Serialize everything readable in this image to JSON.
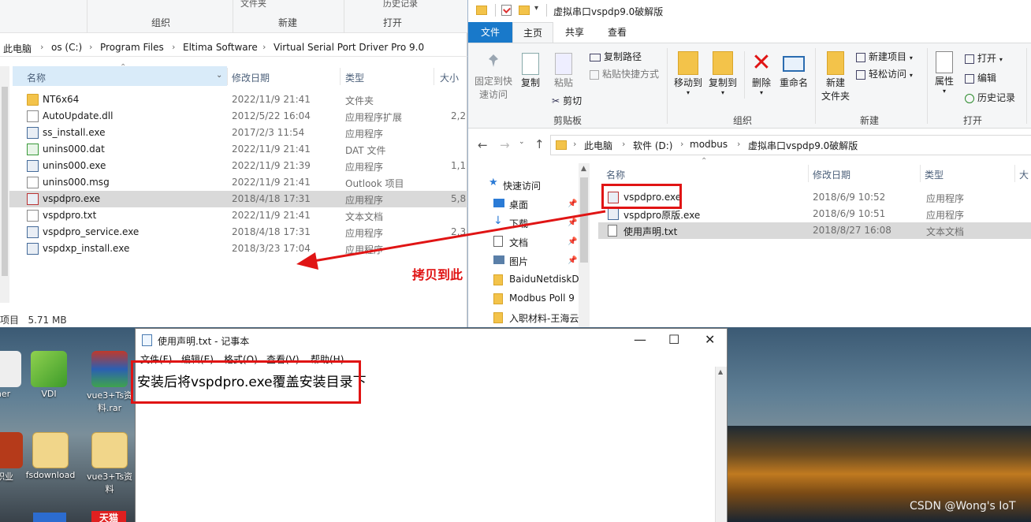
{
  "left_explorer": {
    "ribbon_top": [
      "文件夹",
      "历史记录"
    ],
    "ribbon_groups": [
      "组织",
      "新建",
      "打开"
    ],
    "breadcrumb": [
      "此电脑",
      "os (C:)",
      "Program Files",
      "Eltima Software",
      "Virtual Serial Port Driver Pro 9.0"
    ],
    "columns": {
      "name": "名称",
      "date": "修改日期",
      "type": "类型",
      "size": "大小"
    },
    "files": [
      {
        "name": "NT6x64",
        "date": "2022/11/9 21:41",
        "type": "文件夹",
        "size": "",
        "icon": "folder-icon"
      },
      {
        "name": "AutoUpdate.dll",
        "date": "2012/5/22 16:04",
        "type": "应用程序扩展",
        "size": "2,2",
        "icon": "dll-icon"
      },
      {
        "name": "ss_install.exe",
        "date": "2017/2/3 11:54",
        "type": "应用程序",
        "size": "",
        "icon": "exe-icon"
      },
      {
        "name": "unins000.dat",
        "date": "2022/11/9 21:41",
        "type": "DAT 文件",
        "size": "",
        "icon": "dat-icon"
      },
      {
        "name": "unins000.exe",
        "date": "2022/11/9 21:39",
        "type": "应用程序",
        "size": "1,1",
        "icon": "exe-icon"
      },
      {
        "name": "unins000.msg",
        "date": "2022/11/9 21:41",
        "type": "Outlook 项目",
        "size": "",
        "icon": "msg-icon"
      },
      {
        "name": "vspdpro.exe",
        "date": "2018/4/18 17:31",
        "type": "应用程序",
        "size": "5,8",
        "icon": "exe-icon"
      },
      {
        "name": "vspdpro.txt",
        "date": "2022/11/9 21:41",
        "type": "文本文档",
        "size": "",
        "icon": "txt-icon"
      },
      {
        "name": "vspdpro_service.exe",
        "date": "2018/4/18 17:31",
        "type": "应用程序",
        "size": "2,3",
        "icon": "exe-icon"
      },
      {
        "name": "vspdxp_install.exe",
        "date": "2018/3/23 17:04",
        "type": "应用程序",
        "size": "",
        "icon": "exe-icon"
      }
    ],
    "status": "项目   5.71 MB"
  },
  "right_explorer": {
    "title": "虚拟串口vspdp9.0破解版",
    "tabs": [
      "文件",
      "主页",
      "共享",
      "查看"
    ],
    "ribbon": {
      "pin_quick": "固定到快\n速访问",
      "copy": "复制",
      "paste": "粘贴",
      "copy_path": "复制路径",
      "paste_shortcut": "粘贴快捷方式",
      "cut": "剪切",
      "move_to": "移动到",
      "copy_to": "复制到",
      "delete": "删除",
      "rename": "重命名",
      "new_folder": "新建\n文件夹",
      "new_item": "新建项目",
      "easy_access": "轻松访问",
      "properties": "属性",
      "open": "打开",
      "edit": "编辑",
      "history": "历史记录",
      "group_clipboard": "剪贴板",
      "group_organize": "组织",
      "group_new": "新建",
      "group_open": "打开"
    },
    "breadcrumb": [
      "此电脑",
      "软件 (D:)",
      "modbus",
      "虚拟串口vspdp9.0破解版"
    ],
    "nav": [
      {
        "label": "快速访问",
        "icon": "star-icon",
        "pinned": false
      },
      {
        "label": "桌面",
        "icon": "desktop-icon",
        "pinned": true
      },
      {
        "label": "下载",
        "icon": "download-icon",
        "pinned": true
      },
      {
        "label": "文档",
        "icon": "documents-icon",
        "pinned": true
      },
      {
        "label": "图片",
        "icon": "pictures-icon",
        "pinned": true
      },
      {
        "label": "BaiduNetdiskD",
        "icon": "folder-icon",
        "pinned": false
      },
      {
        "label": "Modbus Poll 9",
        "icon": "folder-icon",
        "pinned": false
      },
      {
        "label": "入职材料-王海云",
        "icon": "folder-icon",
        "pinned": false
      }
    ],
    "columns": {
      "name": "名称",
      "date": "修改日期",
      "type": "类型",
      "size": "大"
    },
    "files": [
      {
        "name": "vspdpro.exe",
        "date": "2018/6/9 10:52",
        "type": "应用程序"
      },
      {
        "name": "vspdpro原版.exe",
        "date": "2018/6/9 10:51",
        "type": "应用程序"
      },
      {
        "name": "使用声明.txt",
        "date": "2018/8/27 16:08",
        "type": "文本文档"
      }
    ]
  },
  "annotation": {
    "text": "拷贝到此",
    "color": "#e01414"
  },
  "notepad": {
    "title": "使用声明.txt - 记事本",
    "menu": [
      "文件(F)",
      "编辑(E)",
      "格式(O)",
      "查看(V)",
      "帮助(H)"
    ],
    "content": "安装后将vspdpro.exe覆盖安装目录下"
  },
  "desktop": {
    "icons": [
      "ner",
      "VDI",
      "vue3+Ts资\n料.rar",
      "职业",
      "fsdownload",
      "vue3+Ts资\n料",
      "天猫"
    ]
  },
  "watermark": "CSDN @Wong's IoT"
}
